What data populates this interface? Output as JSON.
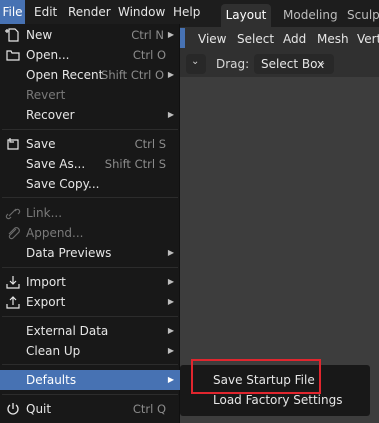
{
  "topbar": {
    "menus": [
      "File",
      "Edit",
      "Render",
      "Window",
      "Help"
    ],
    "workspaces": [
      "Layout",
      "Modeling",
      "Sculpt"
    ]
  },
  "viewport_header": {
    "menus": [
      "View",
      "Select",
      "Add",
      "Mesh",
      "Vert"
    ],
    "drag_label": "Drag:",
    "drag_value": "Select Box"
  },
  "file_menu": {
    "items": [
      {
        "label": "New",
        "shortcut": "Ctrl N",
        "icon": "new-file-icon",
        "submenu": true
      },
      {
        "label": "Open...",
        "shortcut": "Ctrl O",
        "icon": "open-folder-icon"
      },
      {
        "label": "Open Recent",
        "shortcut": "Shift Ctrl O",
        "submenu": true
      },
      {
        "label": "Revert",
        "disabled": true
      },
      {
        "label": "Recover",
        "submenu": true
      },
      {
        "label": "Save",
        "shortcut": "Ctrl S",
        "icon": "save-icon"
      },
      {
        "label": "Save As...",
        "shortcut": "Shift Ctrl S"
      },
      {
        "label": "Save Copy..."
      },
      {
        "label": "Link...",
        "disabled": true,
        "icon": "link-icon"
      },
      {
        "label": "Append...",
        "disabled": true,
        "icon": "append-icon"
      },
      {
        "label": "Data Previews",
        "submenu": true
      },
      {
        "label": "Import",
        "icon": "import-icon",
        "submenu": true
      },
      {
        "label": "Export",
        "icon": "export-icon",
        "submenu": true
      },
      {
        "label": "External Data",
        "submenu": true
      },
      {
        "label": "Clean Up",
        "submenu": true
      },
      {
        "label": "Defaults",
        "submenu": true,
        "active": true
      },
      {
        "label": "Quit",
        "shortcut": "Ctrl Q",
        "icon": "quit-icon"
      }
    ]
  },
  "defaults_submenu": {
    "items": [
      "Save Startup File",
      "Load Factory Settings"
    ]
  },
  "colors": {
    "accent": "#4772b3",
    "menu_bg": "#181818",
    "highlight_border": "#e0262e"
  }
}
